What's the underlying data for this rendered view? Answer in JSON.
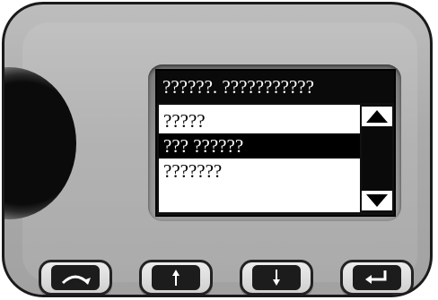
{
  "screen": {
    "title": "??????. ???????????",
    "items": [
      {
        "label": "?????",
        "selected": false
      },
      {
        "label": "??? ??????",
        "selected": true
      },
      {
        "label": "???????",
        "selected": false
      }
    ]
  },
  "scrollbar": {
    "up_icon": "triangle-up-icon",
    "down_icon": "triangle-down-icon"
  },
  "buttons": [
    {
      "name": "back-button",
      "icon": "curved-arrow-icon"
    },
    {
      "name": "up-button",
      "icon": "arrow-up-icon"
    },
    {
      "name": "down-button",
      "icon": "arrow-down-icon"
    },
    {
      "name": "enter-button",
      "icon": "enter-arrow-icon"
    }
  ],
  "colors": {
    "device_body": "#aaaaaa",
    "lcd_dark": "#0a0a0a",
    "lcd_light": "#ffffff"
  }
}
